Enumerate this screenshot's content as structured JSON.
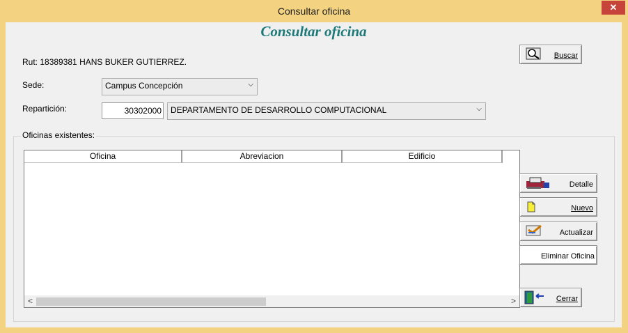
{
  "window": {
    "title": "Consultar oficina",
    "close_symbol": "✕"
  },
  "heading": "Consultar oficina",
  "rut_text": "Rut: 18389381 HANS BUKER GUTIERREZ.",
  "buttons": {
    "buscar": "Buscar",
    "detalle": "Detalle",
    "nuevo": "Nuevo",
    "actualizar": "Actualizar",
    "eliminar": "Eliminar Oficina",
    "cerrar": "Cerrar"
  },
  "sede": {
    "label": "Sede:",
    "value": "Campus Concepción"
  },
  "reparticion": {
    "label": "Repartición:",
    "code": "30302000",
    "value": "DEPARTAMENTO DE DESARROLLO COMPUTACIONAL"
  },
  "oficinas": {
    "label": "Oficinas existentes:",
    "columns": [
      "Oficina",
      "Abreviacion",
      "Edificio"
    ],
    "rows": []
  },
  "scroll": {
    "left": "<",
    "right": ">"
  },
  "colors": {
    "frame": "#f3d381",
    "heading": "#1e7a7a",
    "close": "#c7443a"
  }
}
